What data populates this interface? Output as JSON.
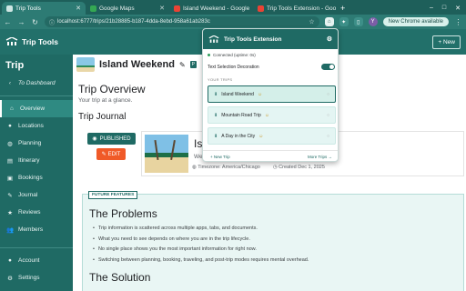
{
  "browser": {
    "tabs": [
      {
        "title": "Trip Tools",
        "color": "#2d7b74"
      },
      {
        "title": "Google Maps",
        "color": "#34a853"
      },
      {
        "title": "Island Weekend - Google",
        "color": "#ea4335"
      },
      {
        "title": "Trip Tools Extension - Goo",
        "color": "#ea4335"
      }
    ],
    "new_tab": "+",
    "window_controls": [
      "–",
      "□",
      "✕"
    ],
    "url": "localhost:6777/trips/21b28885-b187-4dda-8ebd-958a61ab283c",
    "update_label": "New Chrome available",
    "profile_initial": "Y"
  },
  "app": {
    "logo_text": "Trip Tools",
    "new_button": "+ New"
  },
  "sidebar": {
    "title": "Trip",
    "back": "To Dashboard",
    "items": [
      {
        "label": "Overview",
        "icon": "home-icon",
        "glyph": "⌂"
      },
      {
        "label": "Locations",
        "icon": "pin-icon",
        "glyph": "●"
      },
      {
        "label": "Planning",
        "icon": "globe-icon",
        "glyph": "◍"
      },
      {
        "label": "Itinerary",
        "icon": "itinerary-icon",
        "glyph": "▤"
      },
      {
        "label": "Bookings",
        "icon": "bookings-icon",
        "glyph": "▣"
      },
      {
        "label": "Journal",
        "icon": "journal-icon",
        "glyph": "✎"
      },
      {
        "label": "Reviews",
        "icon": "star-icon",
        "glyph": "★"
      },
      {
        "label": "Members",
        "icon": "members-icon",
        "glyph": "👥"
      }
    ],
    "bottom": [
      {
        "label": "Account",
        "icon": "account-icon",
        "glyph": "●"
      },
      {
        "label": "Settings",
        "icon": "settings-icon",
        "glyph": "⚙"
      }
    ]
  },
  "main": {
    "trip_name": "Island Weekend",
    "published_short": "P",
    "overview_heading": "Trip Overview",
    "overview_sub": "Your trip at a glance.",
    "journal_heading": "Trip Journal",
    "published_label": "PUBLISHED",
    "edit_label": "EDIT",
    "card_title": "Is",
    "card_sub": "We",
    "timezone": "Timezone: America/Chicago",
    "created": "Created Dec 1, 2025",
    "future_badge": "FUTURE FEATURES",
    "problems_heading": "The Problems",
    "problems": [
      "Trip information is scattered across multiple apps, tabs, and documents.",
      "What you need to see depends on where you are in the trip lifecycle.",
      "No single place shows you the most important information for right now.",
      "Switching between planning, booking, traveling, and post-trip modes requires mental overhead."
    ],
    "solution_heading": "The Solution"
  },
  "extension": {
    "title": "Trip Tools Extension",
    "status": "Connected (uptime: 0s)",
    "toggle_label": "Text Selection Decoration",
    "toggle_on": true,
    "section_label": "YOUR TRIPS",
    "trips": [
      {
        "name": "Island Weekend",
        "emoji": "☺",
        "selected": true
      },
      {
        "name": "Mountain Road Trip",
        "emoji": "☺",
        "selected": false
      },
      {
        "name": "A Day in the City",
        "emoji": "☺",
        "selected": false
      }
    ],
    "new_trip": "+ New Trip",
    "more_trips": "More Trips →"
  }
}
